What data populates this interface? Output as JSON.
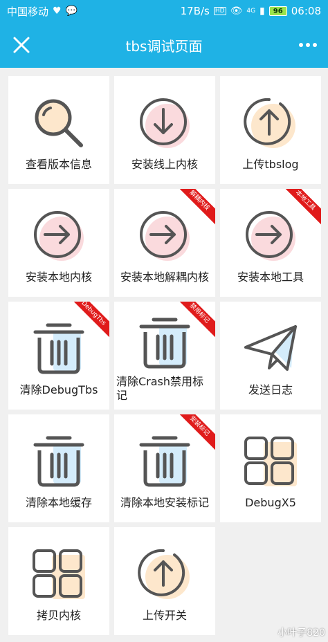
{
  "status": {
    "carrier": "中国移动",
    "speed": "17B/s",
    "net": "4G",
    "hd": "HD",
    "battery": "96",
    "time": "06:08"
  },
  "header": {
    "title": "tbs调试页面"
  },
  "tiles": [
    {
      "label": "查看版本信息",
      "icon": "magnifier-icon"
    },
    {
      "label": "安装线上内核",
      "icon": "arrow-down-circle-icon"
    },
    {
      "label": "上传tbslog",
      "icon": "arrow-up-circle-icon"
    },
    {
      "label": "安装本地内核",
      "icon": "arrow-right-circle-icon"
    },
    {
      "label": "安装本地解耦内核",
      "icon": "arrow-right-circle-icon",
      "ribbon": "解耦内核"
    },
    {
      "label": "安装本地工具",
      "icon": "arrow-right-circle-icon",
      "ribbon": "本地工具"
    },
    {
      "label": "清除DebugTbs",
      "icon": "trash-icon",
      "ribbon": "DebugTbs"
    },
    {
      "label": "清除Crash禁用标记",
      "icon": "trash-icon",
      "ribbon": "禁用标记"
    },
    {
      "label": "发送日志",
      "icon": "paper-plane-icon"
    },
    {
      "label": "清除本地缓存",
      "icon": "trash-icon"
    },
    {
      "label": "清除本地安装标记",
      "icon": "trash-icon",
      "ribbon": "安装标记"
    },
    {
      "label": "DebugX5",
      "icon": "grid-icon"
    },
    {
      "label": "拷贝内核",
      "icon": "grid-icon"
    },
    {
      "label": "上传开关",
      "icon": "arrow-up-circle-icon"
    }
  ],
  "colors": {
    "accent": "#1fb2e5",
    "stroke": "#555555",
    "pink": "#fadadd",
    "peach": "#fde7cc",
    "blue": "#d4ecfb",
    "ribbon": "#e01b1b"
  },
  "watermark": "小叶子820"
}
